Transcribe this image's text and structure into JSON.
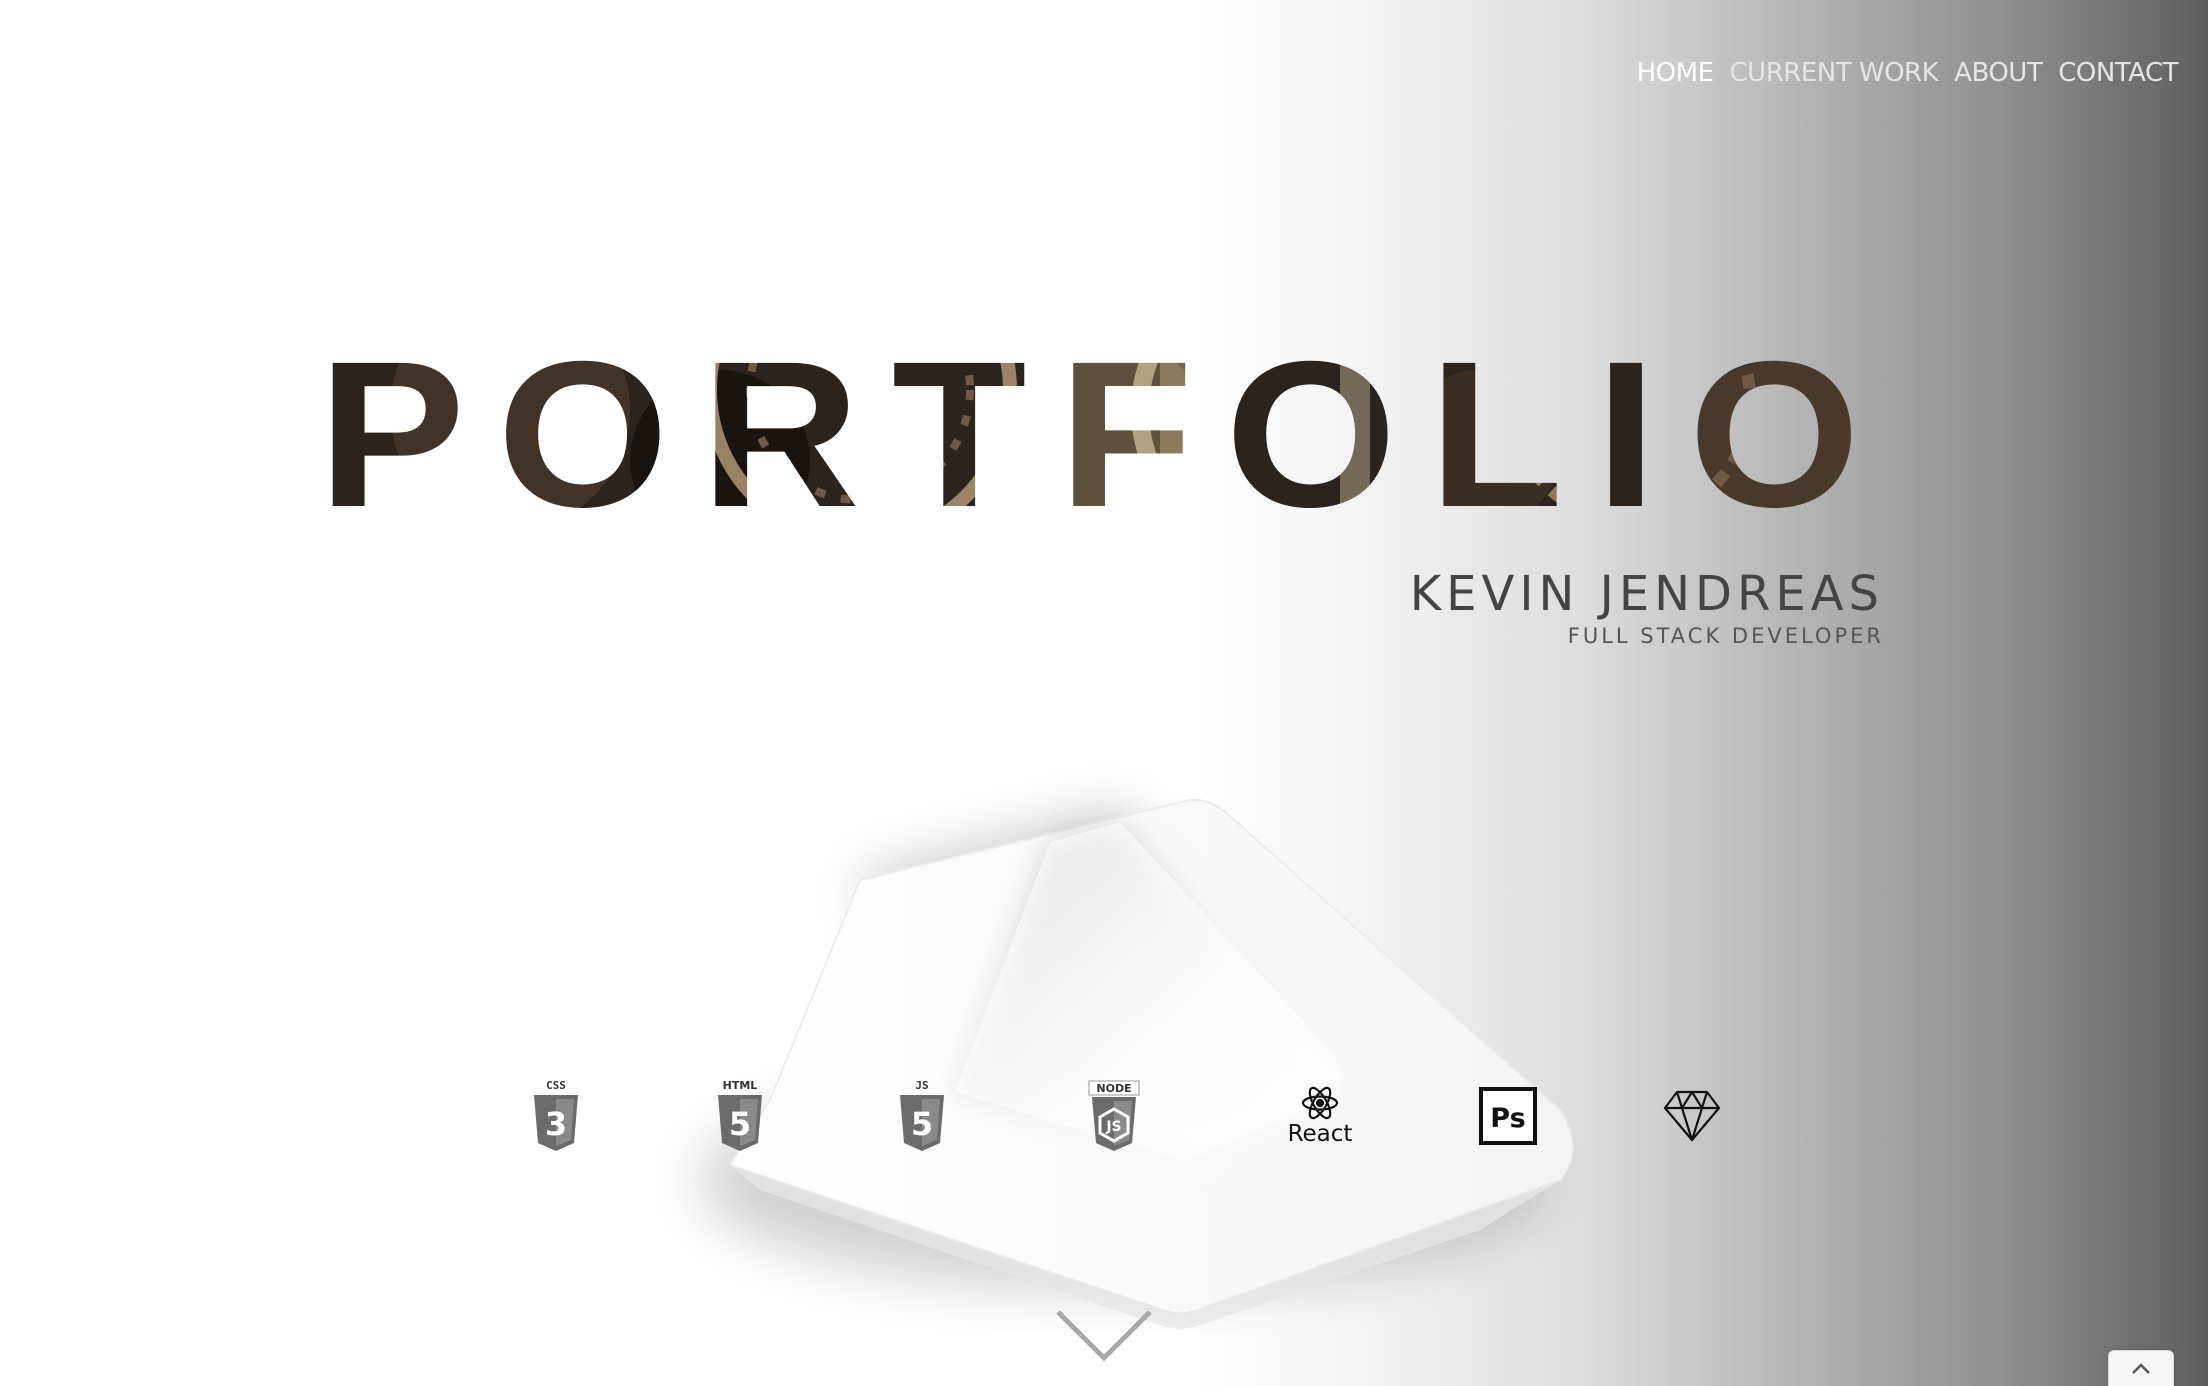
{
  "nav": {
    "items": [
      {
        "label": "HOME",
        "active": true
      },
      {
        "label": "CURRENT WORK",
        "active": false
      },
      {
        "label": "ABOUT",
        "active": false
      },
      {
        "label": "CONTACT",
        "active": false
      }
    ]
  },
  "hero": {
    "title": "PORTFOLIO",
    "name": "KEVIN JENDREAS",
    "role": "FULL STACK DEVELOPER"
  },
  "skills": [
    {
      "icon": "css3-icon",
      "label": "CSS"
    },
    {
      "icon": "html5-icon",
      "label": "HTML"
    },
    {
      "icon": "javascript-icon",
      "label": "JS"
    },
    {
      "icon": "nodejs-icon",
      "label": "NODE"
    },
    {
      "icon": "react-icon",
      "label": "React"
    },
    {
      "icon": "photoshop-icon",
      "label": "Ps"
    },
    {
      "icon": "sketch-icon",
      "label": ""
    }
  ],
  "controls": {
    "scroll_icon": "chevron-down-icon",
    "top_icon": "chevron-up-icon"
  },
  "colors": {
    "title_dark": "#2b231d",
    "title_light": "#b79e78",
    "text": "#444444",
    "nav": "#ffffff"
  }
}
